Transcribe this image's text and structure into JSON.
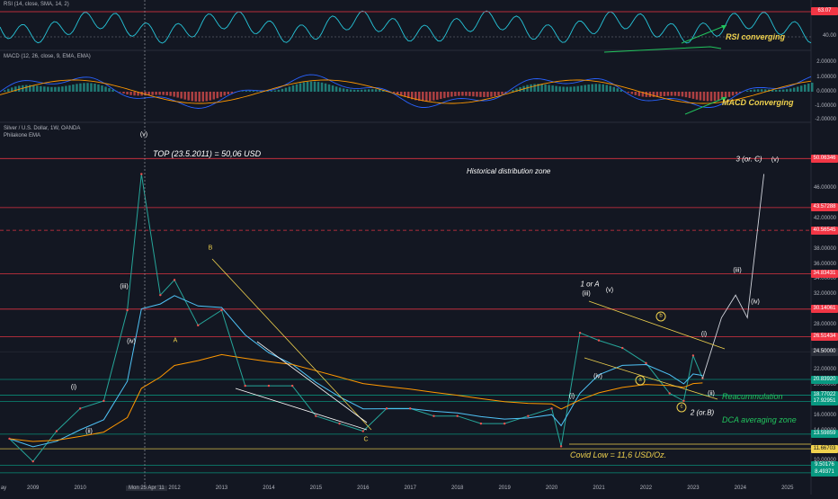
{
  "rsi_pane": {
    "title": "RSI (14, close, SMA, 14, 2)",
    "tag_value": "63.07",
    "tag_color": "#f23645",
    "axis_ticks": [
      "40.00"
    ],
    "annotation": "RSI converging"
  },
  "macd_pane": {
    "title": "MACD (12, 26, close, 9, EMA, EMA)",
    "axis_ticks": [
      "2.00000",
      "1.00000",
      "0.00000",
      "-1.00000",
      "-2.00000"
    ],
    "annotation": "MACD Converging"
  },
  "main_pane": {
    "title": "Silver / U.S. Dollar, 1W, OANDA",
    "subtitle": "Philakone EMA",
    "top_note": "TOP (23.5.2011) = 50,06 USD",
    "distribution_zone": "Historical distribution zone",
    "reaccumulation": "Reacummulation",
    "dca_zone": "DCA averaging zone",
    "covid_low": "Covid Low = 11,6 USD/Oz.",
    "crosshair_date": "Mon 25 Apr '11",
    "axis_ticks": [
      "46.00000",
      "42.00000",
      "38.00000",
      "36.00000",
      "34.00000",
      "32.00000",
      "28.00000",
      "22.00000",
      "20.00000",
      "16.00000",
      "14.00000",
      "10.00000"
    ],
    "price_tags": [
      {
        "value": "50.06346",
        "price": 50.06,
        "color": "#f23645"
      },
      {
        "value": "43.57288",
        "price": 43.57,
        "color": "#f23645"
      },
      {
        "value": "40.56545",
        "price": 40.57,
        "color": "#f23645"
      },
      {
        "value": "34.83431",
        "price": 34.83,
        "color": "#f23645"
      },
      {
        "value": "30.14061",
        "price": 30.14,
        "color": "#f23645"
      },
      {
        "value": "26.51434",
        "price": 26.51,
        "color": "#f23645"
      },
      {
        "value": "24.50000",
        "price": 24.5,
        "color": "#2a2e39"
      },
      {
        "value": "20.83920",
        "price": 20.84,
        "color": "#089981"
      },
      {
        "value": "18.77022",
        "price": 18.77,
        "color": "#089981"
      },
      {
        "value": "17.92951",
        "price": 17.93,
        "color": "#089981"
      },
      {
        "value": "13.59859",
        "price": 13.6,
        "color": "#089981"
      },
      {
        "value": "11.66703",
        "price": 11.67,
        "color": "#f0d24e"
      },
      {
        "value": "9.50176",
        "price": 9.5,
        "color": "#089981"
      },
      {
        "value": "8.49371",
        "price": 8.49,
        "color": "#089981"
      }
    ]
  },
  "x_axis": [
    "ay",
    "2009",
    "2010",
    "2012",
    "2013",
    "2014",
    "2015",
    "2016",
    "2017",
    "2018",
    "2019",
    "2020",
    "2021",
    "2022",
    "2023",
    "2024",
    "2025"
  ],
  "waves": {
    "w_i_2009": "(i)",
    "w_ii_2009": "(ii)",
    "w_iii_2010": "(iii)",
    "w_iv_2010": "(iv)",
    "w_v_2011": "(v)",
    "w_A": "A",
    "w_B": "B",
    "w_C": "C",
    "w_1A": "1 or A",
    "w_iii_2020": "(iii)",
    "w_v_2020": "(v)",
    "w_iv_2020": "(iv)",
    "w_i_2020": "(i)",
    "w_a": "a",
    "w_b": "b",
    "w_c": "c",
    "w_2B": "2 (or.B)",
    "w_i_2022": "(i)",
    "w_ii_2022": "(ii)",
    "w_iii_2023": "(iii)",
    "w_iv_2023": "(iv)",
    "w_3C": "3 (or. C)",
    "w_v_proj": "(v)"
  },
  "chart_data": {
    "type": "line",
    "title": "Silver / U.S. Dollar, 1W, OANDA",
    "x": [
      2008.5,
      2009.0,
      2009.5,
      2010.0,
      2010.5,
      2011.0,
      2011.3,
      2011.7,
      2012.0,
      2012.5,
      2013.0,
      2013.5,
      2014.0,
      2014.5,
      2015.0,
      2015.5,
      2016.0,
      2016.5,
      2017.0,
      2017.5,
      2018.0,
      2018.5,
      2019.0,
      2019.5,
      2020.0,
      2020.2,
      2020.6,
      2021.0,
      2021.5,
      2022.0,
      2022.5,
      2022.8,
      2023.0,
      2023.2
    ],
    "series": [
      {
        "name": "Silver / U.S. Dollar",
        "values": [
          13,
          10,
          14,
          17,
          18,
          30,
          48,
          32,
          34,
          28,
          30,
          20,
          20,
          20,
          16,
          15,
          14,
          17,
          17,
          16,
          16,
          15,
          15,
          16,
          17,
          12,
          27,
          26,
          25,
          23,
          19,
          18,
          24,
          21
        ]
      }
    ],
    "ylim": [
      8,
      52
    ],
    "xlim": [
      2008.3,
      2025.5
    ],
    "projection": {
      "x": [
        2023.2,
        2023.6,
        2023.9,
        2024.15,
        2024.5
      ],
      "y": [
        21,
        29,
        32,
        29,
        48
      ]
    }
  }
}
